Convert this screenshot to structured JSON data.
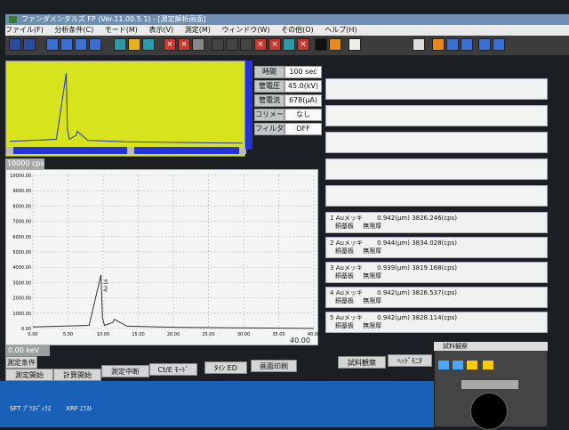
{
  "window": {
    "title": "ファンダメンタルズ FP (Ver.11.00.5.1) - [測定解析画面]"
  },
  "menu": [
    "ファイル(F)",
    "分析条件(C)",
    "モード(M)",
    "表示(V)",
    "測定(M)",
    "ウィンドウ(W)",
    "その他(O)",
    "ヘルプ(H)"
  ],
  "params": [
    {
      "label": "時間",
      "value": "100 sec"
    },
    {
      "label": "管電圧",
      "value": "45.0(kV)"
    },
    {
      "label": "管電流",
      "value": "678(μA)"
    },
    {
      "label": "コリメータ",
      "value": "なし"
    },
    {
      "label": "フィルタ",
      "value": "OFF"
    }
  ],
  "cps_label": "10000 cps",
  "kev_right": "40.00 keV",
  "kev_bottom": "0.00 keV",
  "results": [
    {
      "n": "1",
      "layer": "Auメッキ",
      "value": "0.942(μm)",
      "cps": "3826.246(cps)",
      "base": "銅基板",
      "thick": "無限厚"
    },
    {
      "n": "2",
      "layer": "Auメッキ",
      "value": "0.944(μm)",
      "cps": "3834.028(cps)",
      "base": "銅基板",
      "thick": "無限厚"
    },
    {
      "n": "3",
      "layer": "Auメッキ",
      "value": "0.939(μm)",
      "cps": "3819.168(cps)",
      "base": "銅基板",
      "thick": "無限厚"
    },
    {
      "n": "4",
      "layer": "Auメッキ",
      "value": "0.942(μm)",
      "cps": "3826.537(cps)",
      "base": "銅基板",
      "thick": "無限厚"
    },
    {
      "n": "5",
      "layer": "Auメッキ",
      "value": "0.942(μm)",
      "cps": "3828.114(cps)",
      "base": "銅基板",
      "thick": "無限厚"
    }
  ],
  "bottom_buttons": [
    "測定開始",
    "計算開始",
    "測定中断",
    "Ct/E ﾓｰﾄﾞ",
    "ﾀｲﾝ ED",
    "画面印刷",
    "試料観察",
    "ﾍｯﾄﾞﾓﾆﾀ"
  ],
  "side_labels": [
    "測定条件",
    "測定開始"
  ],
  "sample_window_title": "試料観察",
  "desktop_icons": [
    "SFT ﾌﾟﾗｽﾃﾞｨｸｽ",
    "XRF ｴﾗｽﾄ"
  ],
  "chart_data": {
    "type": "line",
    "xlabel": "keV",
    "xlim": [
      0,
      40
    ],
    "ylim": [
      0,
      10000
    ],
    "y_ticks": [
      "10000.00",
      "9000.00",
      "8000.00",
      "7000.00",
      "6000.00",
      "5000.00",
      "4000.00",
      "3000.00",
      "2000.00",
      "1000.00",
      "0.00"
    ],
    "x_ticks": [
      "0.00",
      "5.00",
      "10.00",
      "15.00",
      "20.00",
      "25.00",
      "30.00",
      "35.00",
      "40.00"
    ],
    "annotations": [
      "Au La"
    ],
    "x": [
      0,
      8,
      9.7,
      9.9,
      10.2,
      11.4,
      11.6,
      13.4,
      20,
      30,
      40
    ],
    "y": [
      100,
      200,
      3500,
      700,
      200,
      400,
      600,
      150,
      80,
      40,
      10
    ]
  }
}
